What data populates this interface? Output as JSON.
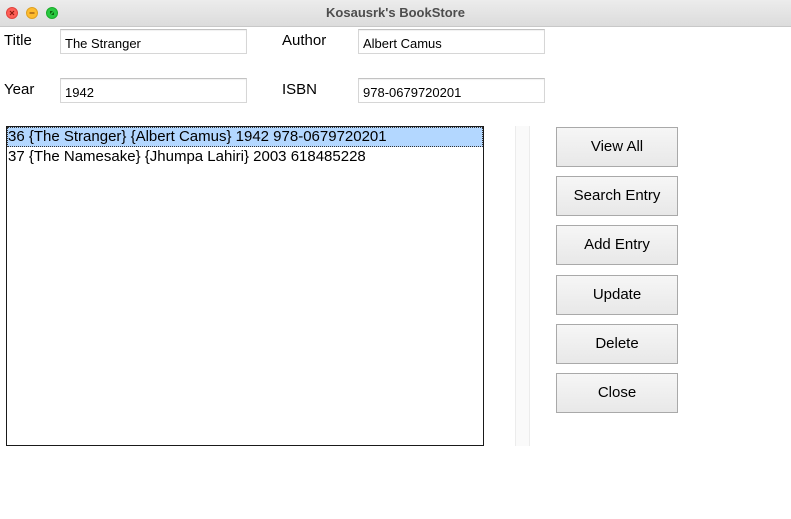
{
  "window": {
    "title": "Kosausrk's BookStore"
  },
  "form": {
    "title_label": "Title",
    "title_value": "The Stranger",
    "author_label": "Author",
    "author_value": "Albert Camus",
    "year_label": "Year",
    "year_value": "1942",
    "isbn_label": "ISBN",
    "isbn_value": "978-0679720201"
  },
  "list": {
    "items": [
      "36 {The Stranger} {Albert Camus} 1942 978-0679720201",
      "37 {The Namesake} {Jhumpa Lahiri} 2003 618485228"
    ],
    "selected_index": 0
  },
  "buttons": {
    "view_all": "View All",
    "search_entry": "Search Entry",
    "add_entry": "Add Entry",
    "update": "Update",
    "delete": "Delete",
    "close": "Close"
  },
  "colors": {
    "selection": "#b3d7ff",
    "close_light": "#fe5f57",
    "minimize_light": "#febc2e",
    "maximize_light": "#28c840"
  }
}
